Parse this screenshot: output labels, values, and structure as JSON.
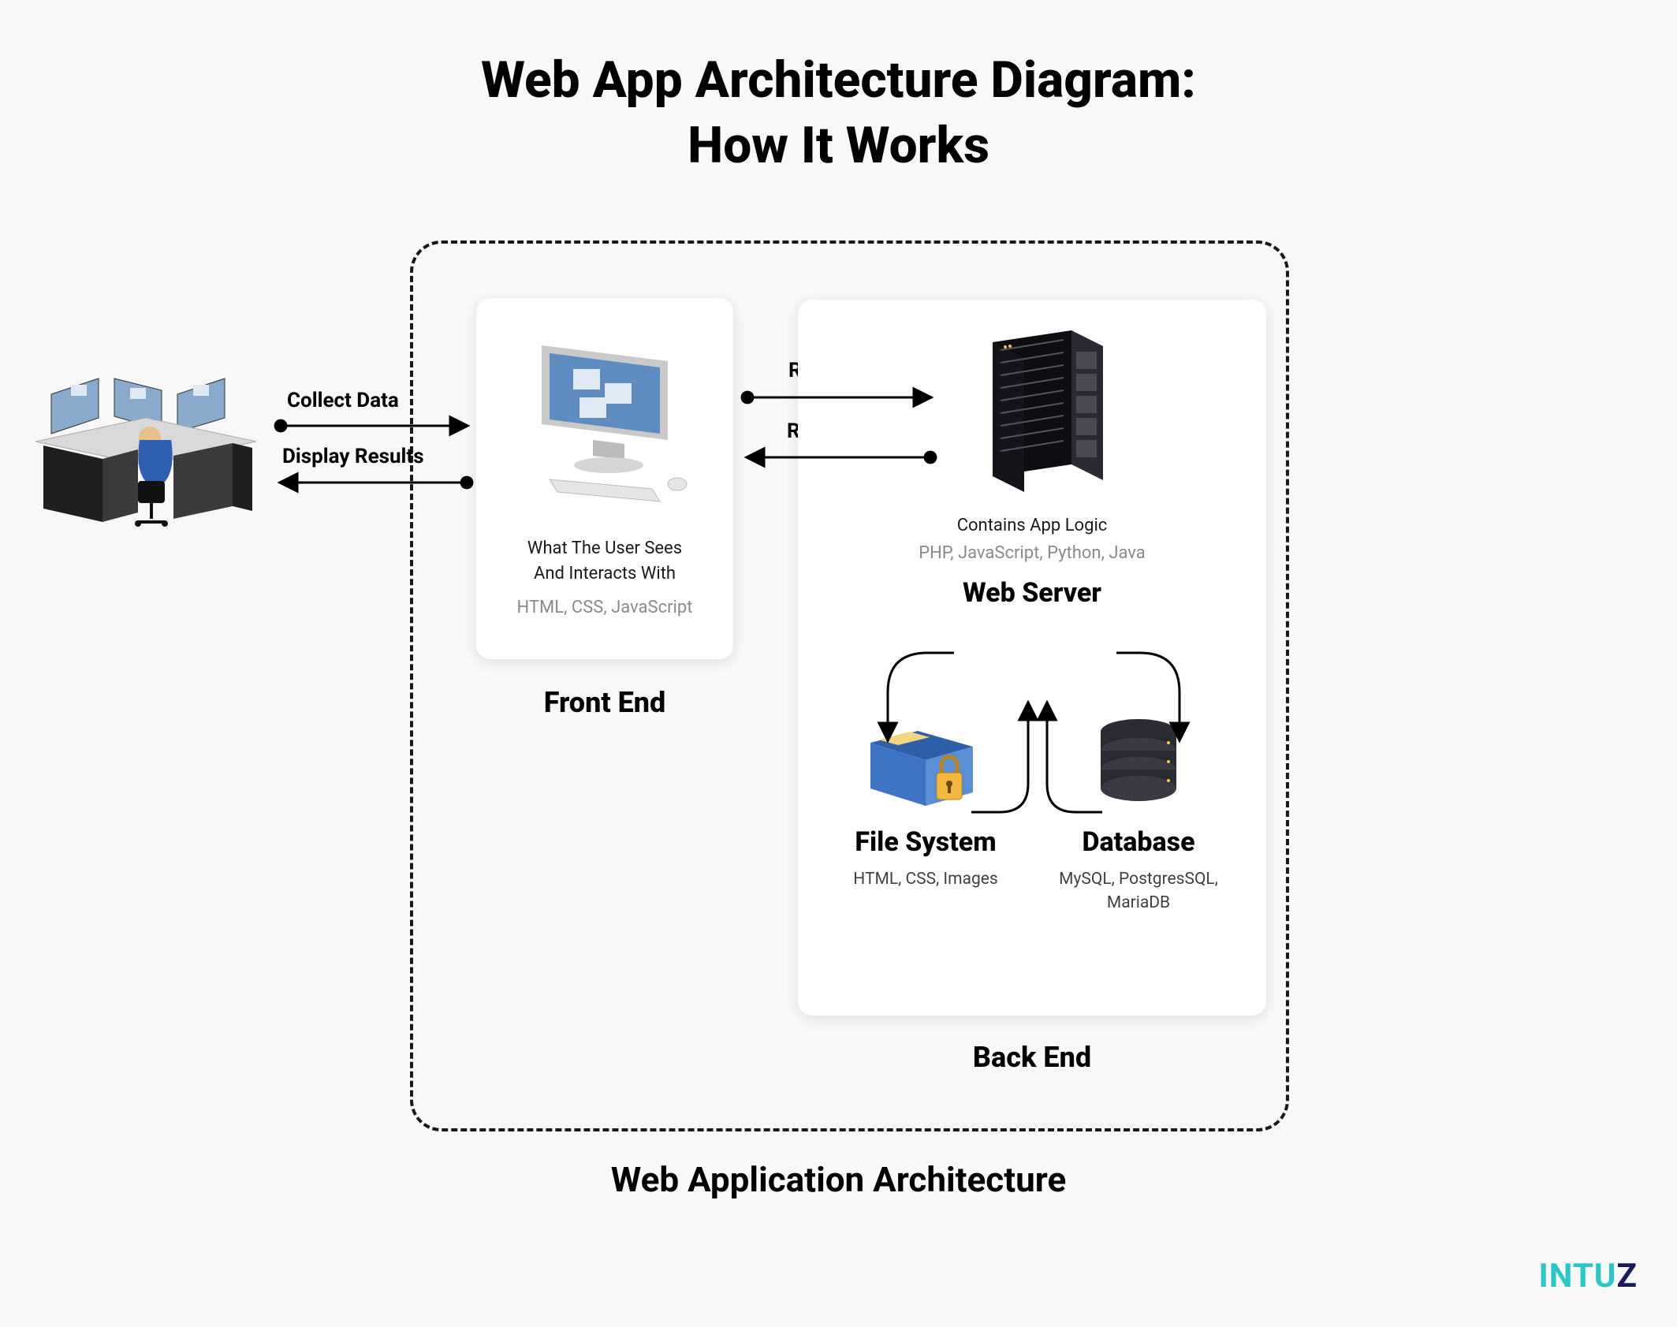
{
  "title_line1": "Web App Architecture Diagram:",
  "title_line2": "How It Works",
  "architecture_box_label": "Web Application Architecture",
  "brand": {
    "part1": "INTU",
    "part2": "Z"
  },
  "user_frontend_arrows": {
    "to_frontend": "Collect Data",
    "to_user": "Display Results"
  },
  "frontend_backend_arrows": {
    "to_backend": "Request",
    "to_frontend": "Response"
  },
  "frontend": {
    "label": "Front End",
    "description_line1": "What The User Sees",
    "description_line2": "And Interacts With",
    "tech": "HTML, CSS, JavaScript"
  },
  "backend": {
    "label": "Back End",
    "server": {
      "description": "Contains App Logic",
      "tech": "PHP, JavaScript, Python, Java",
      "label": "Web Server"
    },
    "filesystem": {
      "label": "File System",
      "tech": "HTML, CSS, Images"
    },
    "database": {
      "label": "Database",
      "tech": "MySQL, PostgresSQL, MariaDB"
    }
  }
}
